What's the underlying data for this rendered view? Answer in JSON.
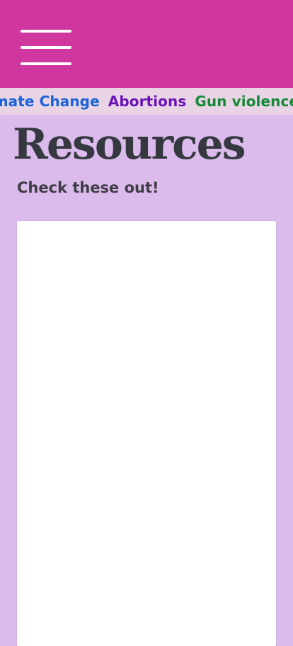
{
  "header": {
    "menu_icon": "hamburger-menu-icon",
    "background_color": "#cf369e"
  },
  "topics": [
    {
      "label": "Climate Change",
      "color": "#1a63d8"
    },
    {
      "label": "Abortions",
      "color": "#6a14b8"
    },
    {
      "label": "Gun violence",
      "color": "#148a38"
    }
  ],
  "main": {
    "title": "Resources",
    "subtitle": "Check these out!"
  }
}
